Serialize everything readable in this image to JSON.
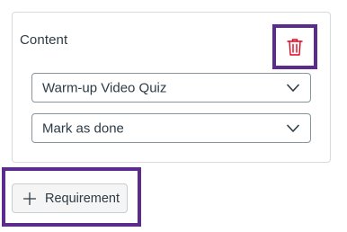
{
  "requirement_card": {
    "label": "Content",
    "content_select": {
      "value": "Warm-up Video Quiz"
    },
    "action_select": {
      "value": "Mark as done"
    },
    "delete_icon": "trash-icon"
  },
  "add_requirement": {
    "label": "Requirement",
    "icon": "plus-icon"
  },
  "colors": {
    "highlight": "#5b2c8e",
    "delete": "#e0061f",
    "text": "#2d3b45",
    "border": "#8b9499"
  }
}
